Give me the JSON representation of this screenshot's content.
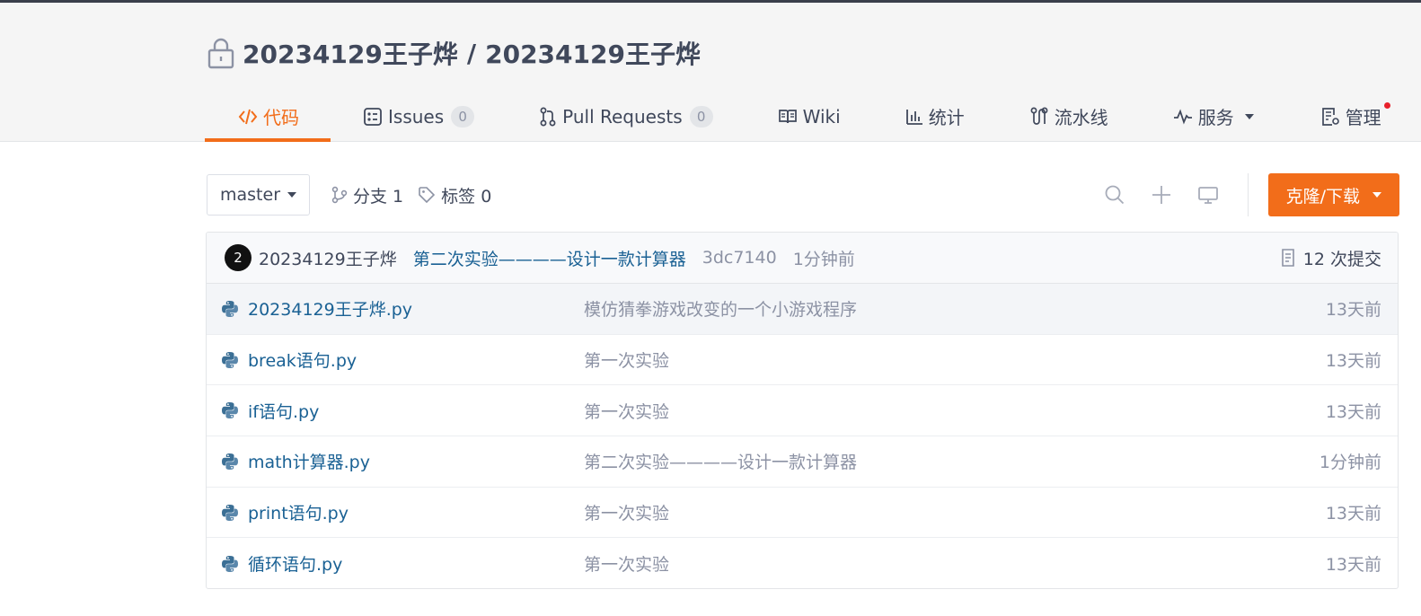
{
  "repo": {
    "owner": "20234129王子烨",
    "separator": "/",
    "name": "20234129王子烨"
  },
  "tabs": [
    {
      "label": "代码",
      "icon": "code-icon",
      "active": true
    },
    {
      "label": "Issues",
      "icon": "issues-icon",
      "count": "0"
    },
    {
      "label": "Pull Requests",
      "icon": "pull-request-icon",
      "count": "0"
    },
    {
      "label": "Wiki",
      "icon": "book-icon"
    },
    {
      "label": "统计",
      "icon": "stats-icon"
    },
    {
      "label": "流水线",
      "icon": "pipeline-icon"
    },
    {
      "label": "服务",
      "icon": "pulse-icon"
    },
    {
      "label": "管理",
      "icon": "manage-icon"
    }
  ],
  "toolbar": {
    "branch": "master",
    "branches_label": "分支 1",
    "tags_label": "标签 0",
    "clone_label": "克隆/下载"
  },
  "last_commit": {
    "avatar_text": "2",
    "author": "20234129王子烨",
    "message": "第二次实验————设计一款计算器",
    "sha": "3dc7140",
    "time": "1分钟前",
    "commit_count": "12 次提交"
  },
  "files": [
    {
      "name": "20234129王子烨.py",
      "message": "模仿猜拳游戏改变的一个小游戏程序",
      "time": "13天前"
    },
    {
      "name": "break语句.py",
      "message": "第一次实验",
      "time": "13天前"
    },
    {
      "name": "if语句.py",
      "message": "第一次实验",
      "time": "13天前"
    },
    {
      "name": "math计算器.py",
      "message": "第二次实验————设计一款计算器",
      "time": "1分钟前"
    },
    {
      "name": "print语句.py",
      "message": "第一次实验",
      "time": "13天前"
    },
    {
      "name": "循环语句.py",
      "message": "第一次实验",
      "time": "13天前"
    }
  ],
  "colors": {
    "accent": "#f26d1a",
    "link": "#1a6194",
    "muted": "#8c92a4",
    "notify_dot": "#e8202a"
  }
}
